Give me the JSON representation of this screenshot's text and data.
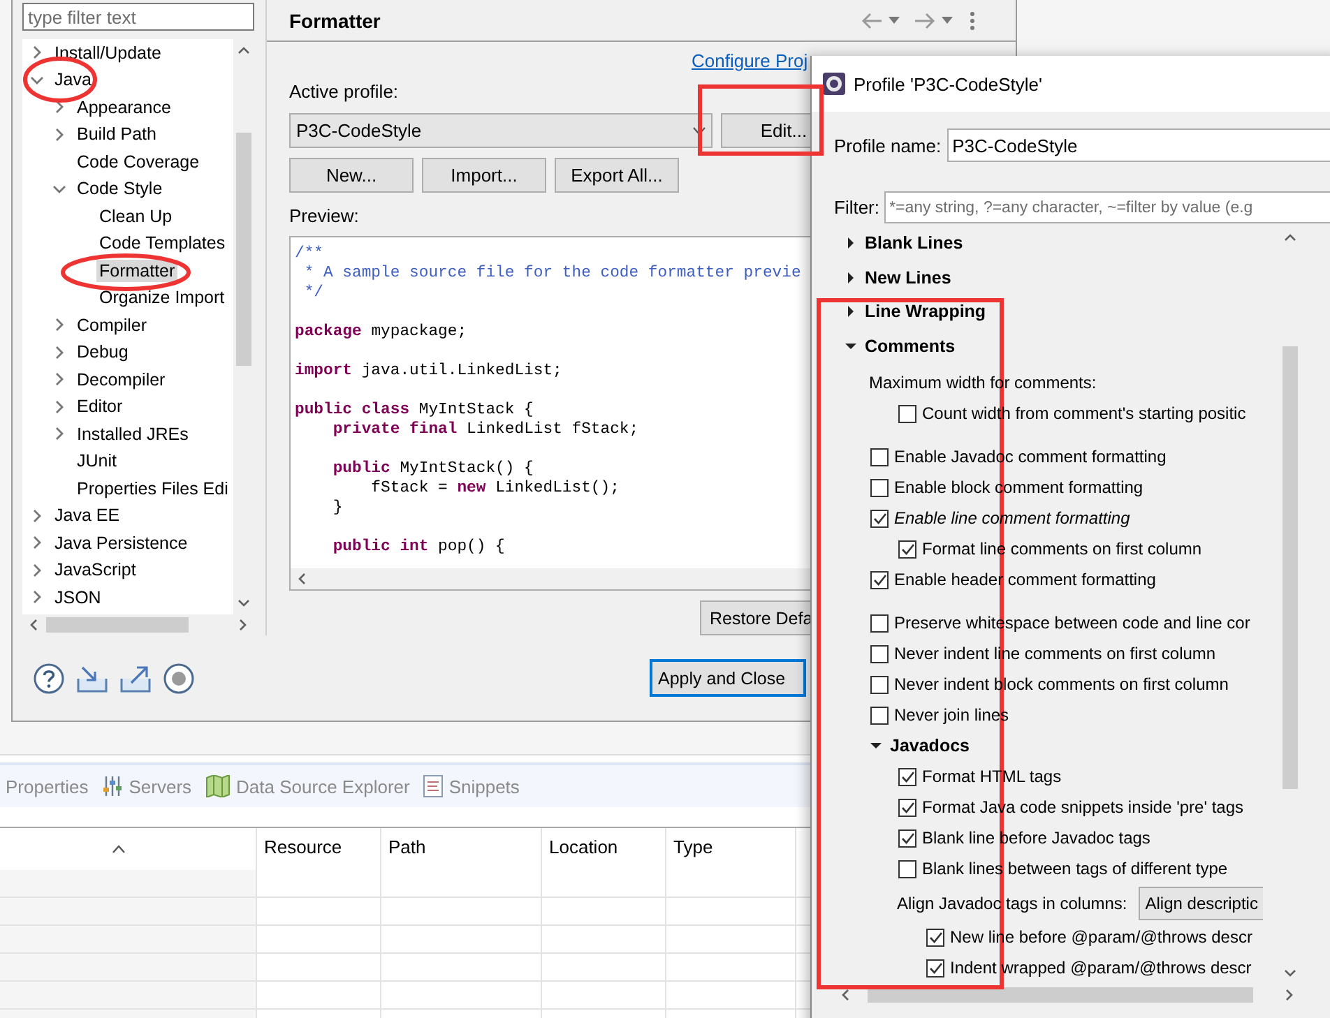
{
  "preferences": {
    "filter": {
      "placeholder": "type filter text"
    },
    "tree": [
      {
        "label": "Install/Update",
        "expanded": false,
        "selected": false
      },
      {
        "label": "Java",
        "expanded": true,
        "selected": false,
        "children": [
          {
            "label": "Appearance",
            "expanded": false,
            "selected": false
          },
          {
            "label": "Build Path",
            "expanded": false,
            "selected": false
          },
          {
            "label": "Code Coverage",
            "selected": false
          },
          {
            "label": "Code Style",
            "expanded": true,
            "selected": false,
            "children": [
              {
                "label": "Clean Up",
                "selected": false
              },
              {
                "label": "Code Templates",
                "selected": false
              },
              {
                "label": "Formatter",
                "selected": true
              },
              {
                "label": "Organize Import",
                "selected": false
              }
            ]
          },
          {
            "label": "Compiler",
            "expanded": false,
            "selected": false
          },
          {
            "label": "Debug",
            "expanded": false,
            "selected": false
          },
          {
            "label": "Decompiler",
            "expanded": false,
            "selected": false
          },
          {
            "label": "Editor",
            "expanded": false,
            "selected": false
          },
          {
            "label": "Installed JREs",
            "expanded": false,
            "selected": false
          },
          {
            "label": "JUnit",
            "selected": false
          },
          {
            "label": "Properties Files Edi",
            "selected": false
          }
        ]
      },
      {
        "label": "Java EE",
        "expanded": false,
        "selected": false
      },
      {
        "label": "Java Persistence",
        "expanded": false,
        "selected": false
      },
      {
        "label": "JavaScript",
        "expanded": false,
        "selected": false
      },
      {
        "label": "JSON",
        "expanded": false,
        "selected": false
      }
    ],
    "page": {
      "title": "Formatter",
      "link": "Configure Proj",
      "active_profile_label": "Active profile:",
      "profile": "P3C-CodeStyle",
      "edit_button": "Edit...",
      "buttons": [
        "New...",
        "Import...",
        "Export All..."
      ],
      "preview_label": "Preview:",
      "preview": [
        {
          "kind": "code",
          "tokens": [
            {
              "text": "/**",
              "kind": "comment"
            }
          ]
        },
        {
          "kind": "code",
          "tokens": [
            {
              "text": " * A sample source file for the code formatter previe",
              "kind": "comment"
            }
          ]
        },
        {
          "kind": "code",
          "tokens": [
            {
              "text": " */",
              "kind": "comment"
            }
          ]
        },
        {
          "kind": "blank"
        },
        {
          "kind": "code",
          "tokens": [
            {
              "text": "package",
              "kind": "keyword"
            },
            {
              "text": " mypackage;",
              "kind": "plain"
            }
          ]
        },
        {
          "kind": "blank"
        },
        {
          "kind": "code",
          "tokens": [
            {
              "text": "import",
              "kind": "keyword"
            },
            {
              "text": " java.util.LinkedList;",
              "kind": "plain"
            }
          ]
        },
        {
          "kind": "blank"
        },
        {
          "kind": "code",
          "tokens": [
            {
              "text": "public class",
              "kind": "keyword"
            },
            {
              "text": " MyIntStack {",
              "kind": "plain"
            }
          ]
        },
        {
          "kind": "code",
          "tokens": [
            {
              "text": "    private final",
              "kind": "keyword"
            },
            {
              "text": " LinkedList fStack;",
              "kind": "plain"
            }
          ]
        },
        {
          "kind": "blank"
        },
        {
          "kind": "code",
          "tokens": [
            {
              "text": "    public",
              "kind": "keyword"
            },
            {
              "text": " MyIntStack() {",
              "kind": "plain"
            }
          ]
        },
        {
          "kind": "code",
          "tokens": [
            {
              "text": "        fStack = ",
              "kind": "plain"
            },
            {
              "text": "new",
              "kind": "keyword"
            },
            {
              "text": " LinkedList();",
              "kind": "plain"
            }
          ]
        },
        {
          "kind": "code",
          "tokens": [
            {
              "text": "    }",
              "kind": "plain"
            }
          ]
        },
        {
          "kind": "blank"
        },
        {
          "kind": "code",
          "tokens": [
            {
              "text": "    public int",
              "kind": "keyword"
            },
            {
              "text": " pop() {",
              "kind": "plain"
            }
          ]
        }
      ],
      "restore_button": "Restore Defa"
    },
    "apply_button": "Apply and Close"
  },
  "profile_dialog": {
    "title": "Profile 'P3C-CodeStyle'",
    "name_label": "Profile name:",
    "name": "P3C-CodeStyle",
    "filter_label": "Filter:",
    "filter_placeholder": "*=any string, ?=any character, ~=filter by value (e.g",
    "sections": [
      {
        "label": "Blank Lines",
        "expanded": false
      },
      {
        "label": "New Lines",
        "expanded": false
      },
      {
        "label": "Line Wrapping",
        "expanded": false
      },
      {
        "label": "Comments",
        "expanded": true,
        "blocks": [
          {
            "items": [
              {
                "kind": "label",
                "text": "Maximum width for comments:",
                "children": [
                  {
                    "kind": "checkbox",
                    "text": "Count width from comment's starting positic",
                    "checked": false,
                    "modified": false
                  }
                ]
              }
            ]
          },
          {
            "items": [
              {
                "kind": "checkbox",
                "text": "Enable Javadoc comment formatting",
                "checked": false,
                "modified": false
              },
              {
                "kind": "checkbox",
                "text": "Enable block comment formatting",
                "checked": false,
                "modified": false
              },
              {
                "kind": "checkbox",
                "text": "Enable line comment formatting",
                "checked": true,
                "modified": true,
                "children": [
                  {
                    "kind": "checkbox",
                    "text": "Format line comments on first column",
                    "checked": true,
                    "modified": false
                  }
                ]
              },
              {
                "kind": "checkbox",
                "text": "Enable header comment formatting",
                "checked": true,
                "modified": false
              }
            ]
          },
          {
            "items": [
              {
                "kind": "checkbox",
                "text": "Preserve whitespace between code and line cor",
                "checked": false,
                "modified": false
              },
              {
                "kind": "checkbox",
                "text": "Never indent line comments on first column",
                "checked": false,
                "modified": false
              },
              {
                "kind": "checkbox",
                "text": "Never indent block comments on first column",
                "checked": false,
                "modified": false
              },
              {
                "kind": "checkbox",
                "text": "Never join lines",
                "checked": false,
                "modified": false
              },
              {
                "kind": "group",
                "text": "Javadocs",
                "expanded": true,
                "children": [
                  {
                    "kind": "checkbox",
                    "text": "Format HTML tags",
                    "checked": true,
                    "modified": false
                  },
                  {
                    "kind": "checkbox",
                    "text": "Format Java code snippets inside 'pre' tags",
                    "checked": true,
                    "modified": false
                  },
                  {
                    "kind": "checkbox",
                    "text": "Blank line before Javadoc tags",
                    "checked": true,
                    "modified": false
                  },
                  {
                    "kind": "checkbox",
                    "text": "Blank lines between tags of different type",
                    "checked": false,
                    "modified": false
                  },
                  {
                    "kind": "combo",
                    "text": "Align Javadoc tags in columns:",
                    "value": "Align descriptic",
                    "children": [
                      {
                        "kind": "checkbox",
                        "text": "New line before @param/@throws descr",
                        "checked": true,
                        "modified": false
                      },
                      {
                        "kind": "checkbox",
                        "text": "Indent wrapped @param/@throws descr",
                        "checked": true,
                        "modified": false
                      }
                    ]
                  }
                ]
              }
            ]
          }
        ]
      }
    ]
  },
  "bottom_panel": {
    "tabs": [
      {
        "label": "Properties"
      },
      {
        "label": "Servers"
      },
      {
        "label": "Data Source Explorer"
      },
      {
        "label": "Snippets"
      }
    ],
    "table": {
      "first_column": {
        "sort_indicator": true
      },
      "columns": [
        "Resource",
        "Path",
        "Location",
        "Type"
      ]
    }
  }
}
